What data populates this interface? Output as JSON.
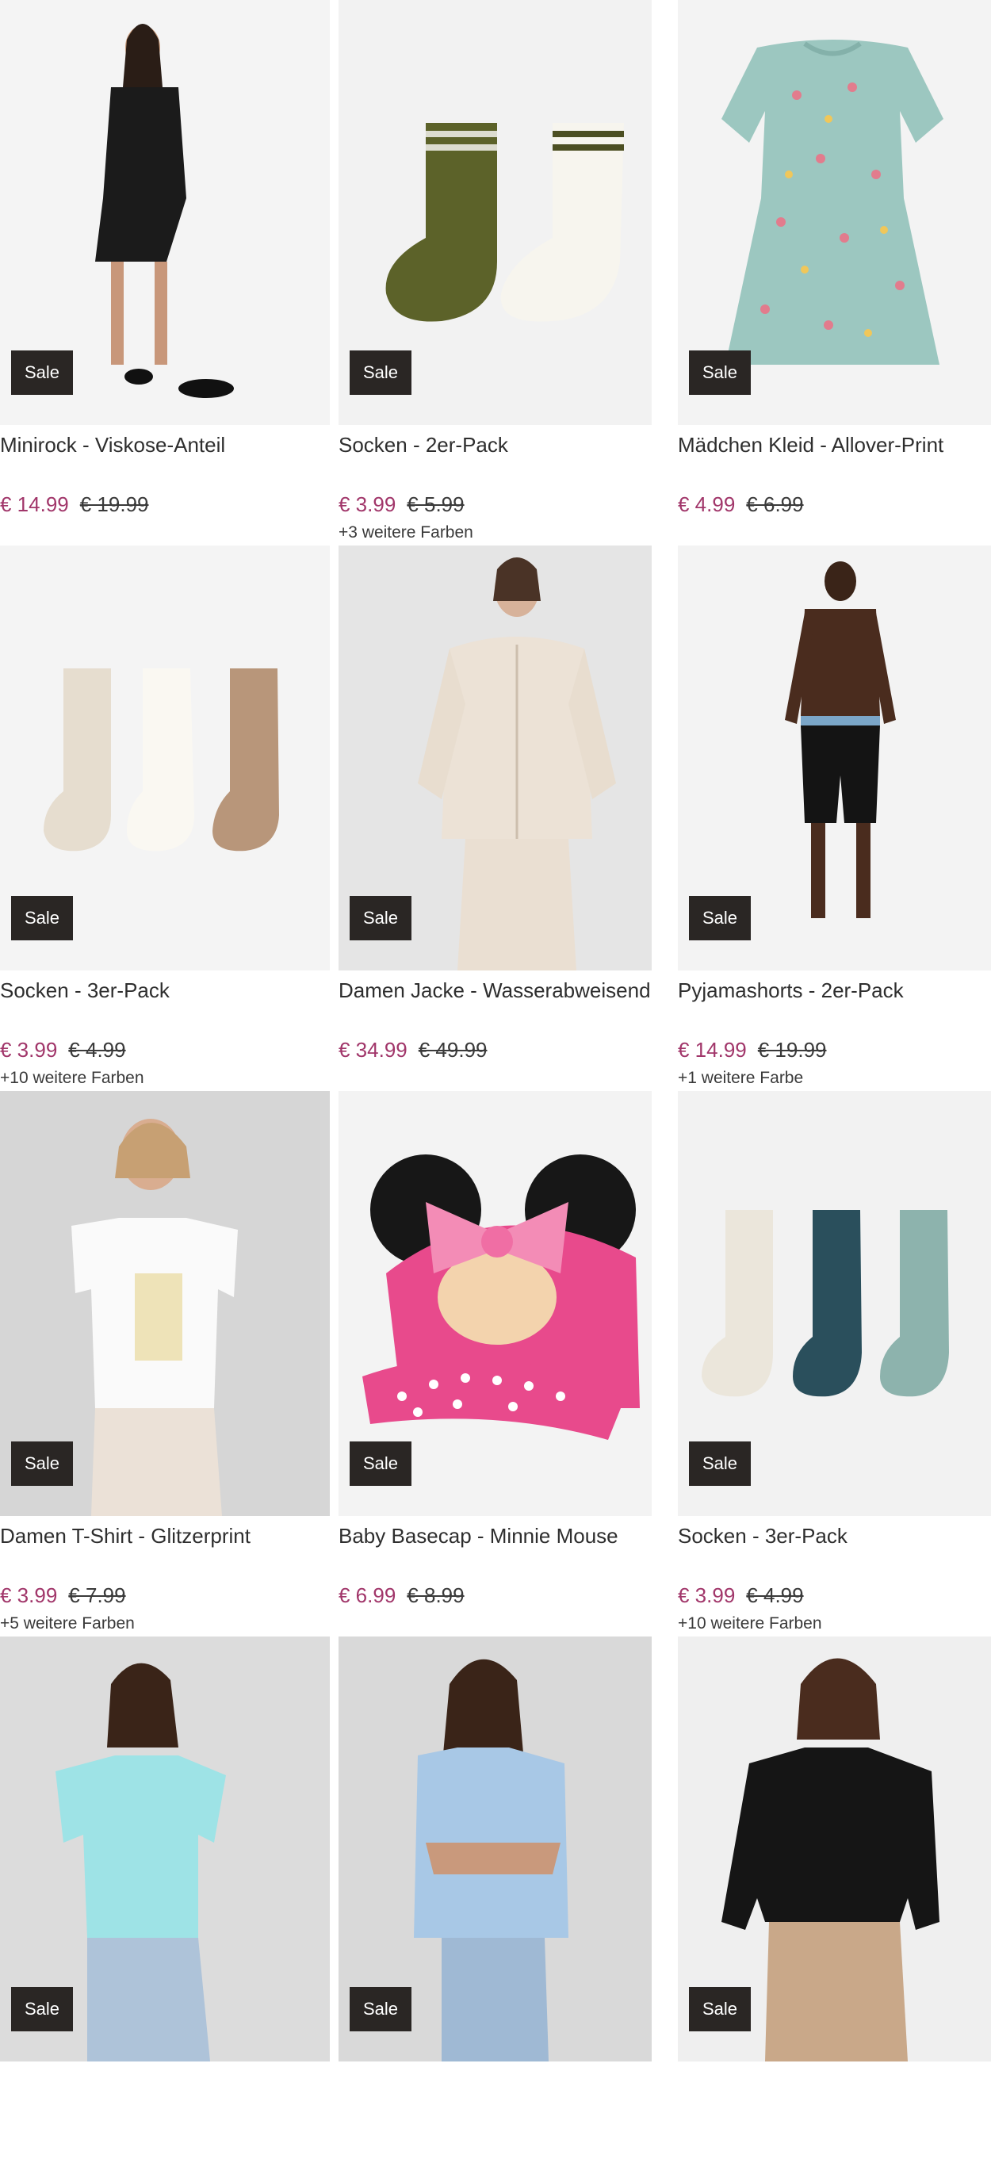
{
  "badge_label": "Sale",
  "products": [
    {
      "title": "Minirock - Viskose-Anteil",
      "price": "€ 14.99",
      "old_price": "€ 19.99",
      "colors": "",
      "bg": "#f2f2f2"
    },
    {
      "title": "Socken - 2er-Pack",
      "price": "€ 3.99",
      "old_price": "€ 5.99",
      "colors": "+3 weitere Farben",
      "bg": "#f2f2f2"
    },
    {
      "title": "Mädchen Kleid - Allover-Print",
      "price": "€ 4.99",
      "old_price": "€ 6.99",
      "colors": "",
      "bg": "#f2f2f2"
    },
    {
      "title": "Socken - 3er-Pack",
      "price": "€ 3.99",
      "old_price": "€ 4.99",
      "colors": "+10 weitere Farben",
      "bg": "#f2f2f2"
    },
    {
      "title": "Damen Jacke - Wasserabweisend",
      "price": "€ 34.99",
      "old_price": "€ 49.99",
      "colors": "",
      "bg": "#e4e4e4"
    },
    {
      "title": "Pyjamashorts - 2er-Pack",
      "price": "€ 14.99",
      "old_price": "€ 19.99",
      "colors": "+1 weitere Farbe",
      "bg": "#f2f2f2"
    },
    {
      "title": "Damen T-Shirt - Glitzerprint",
      "price": "€ 3.99",
      "old_price": "€ 7.99",
      "colors": "+5 weitere Farben",
      "bg": "#d8d8d8"
    },
    {
      "title": "Baby Basecap - Minnie Mouse",
      "price": "€ 6.99",
      "old_price": "€ 8.99",
      "colors": "",
      "bg": "#f2f2f2"
    },
    {
      "title": "Socken - 3er-Pack",
      "price": "€ 3.99",
      "old_price": "€ 4.99",
      "colors": "+10 weitere Farben",
      "bg": "#f2f2f2"
    },
    {
      "title": "",
      "price": "",
      "old_price": "",
      "colors": "",
      "bg": "#dcdcdc"
    },
    {
      "title": "",
      "price": "",
      "old_price": "",
      "colors": "",
      "bg": "#d9d9d9"
    },
    {
      "title": "",
      "price": "",
      "old_price": "",
      "colors": "",
      "bg": "#efefef"
    }
  ],
  "colors": {
    "sale_badge": "#2a2624",
    "price_new": "#a1366a",
    "price_old": "#3a3a3a"
  }
}
